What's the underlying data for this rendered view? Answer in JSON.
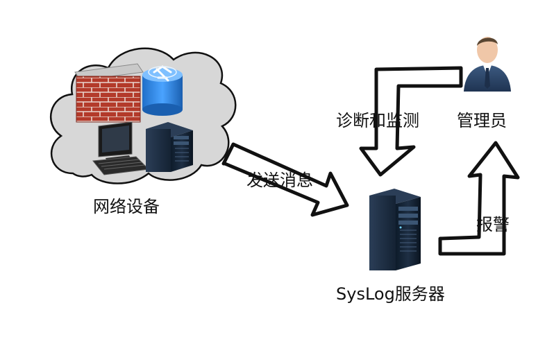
{
  "nodes": {
    "network_devices": {
      "label": "网络设备"
    },
    "administrator": {
      "label": "管理员"
    },
    "syslog_server": {
      "label": "SysLog服务器"
    }
  },
  "edges": {
    "send_message": {
      "label": "发送消息"
    },
    "diagnose_monitor": {
      "label": "诊断和监测"
    },
    "alert": {
      "label": "报警"
    }
  }
}
